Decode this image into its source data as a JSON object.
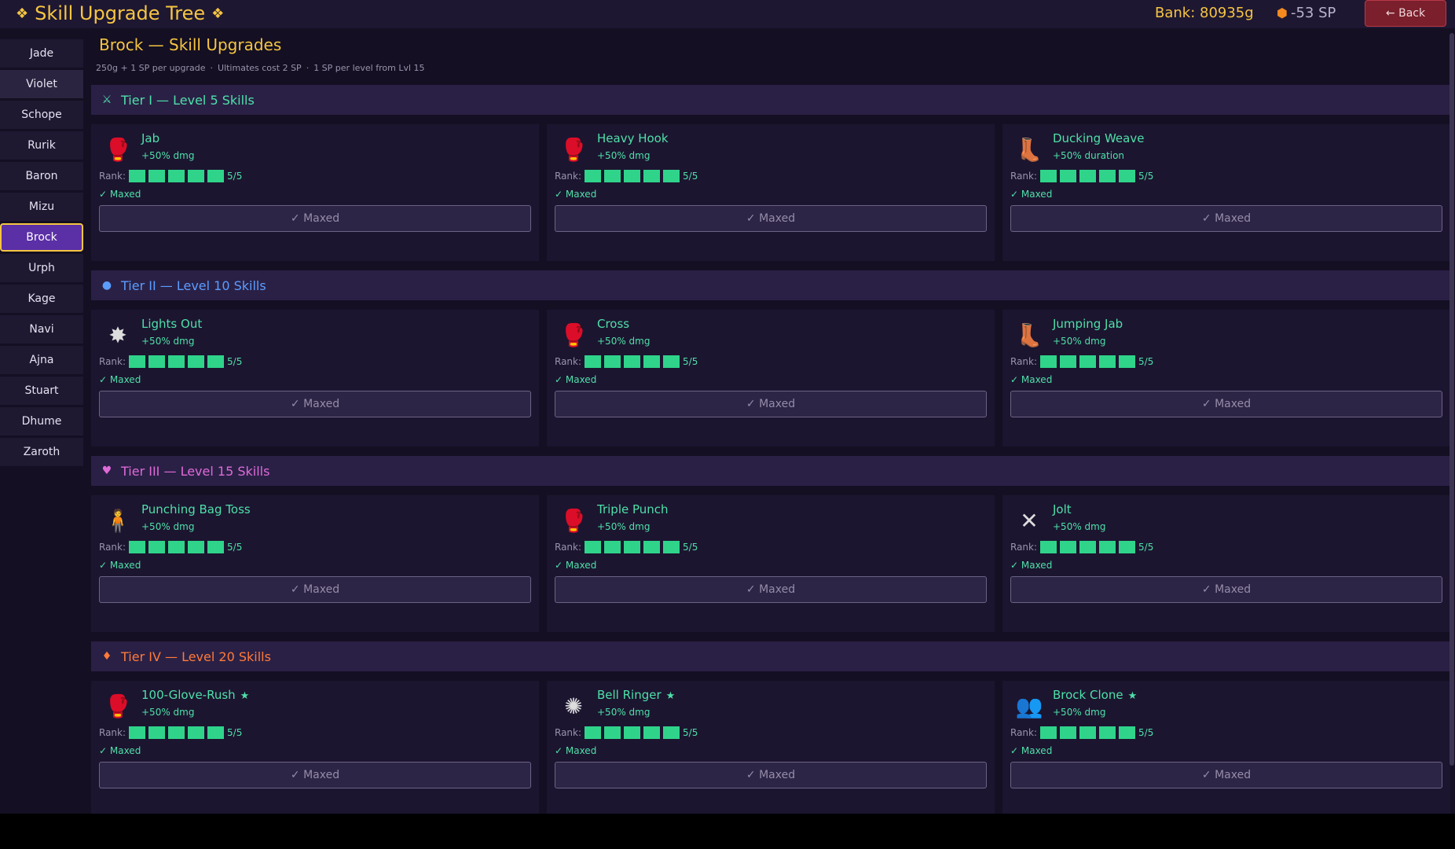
{
  "header": {
    "title": "Skill Upgrade Tree",
    "diamond": "❖",
    "bank": "Bank: 80935g",
    "sp": "-53 SP",
    "back_label": "← Back"
  },
  "sidebar": {
    "items": [
      {
        "label": "Jade"
      },
      {
        "label": "Violet"
      },
      {
        "label": "Schope"
      },
      {
        "label": "Rurik"
      },
      {
        "label": "Baron"
      },
      {
        "label": "Mizu"
      },
      {
        "label": "Brock"
      },
      {
        "label": "Urph"
      },
      {
        "label": "Kage"
      },
      {
        "label": "Navi"
      },
      {
        "label": "Ajna"
      },
      {
        "label": "Stuart"
      },
      {
        "label": "Dhume"
      },
      {
        "label": "Zaroth"
      }
    ],
    "active": "Brock"
  },
  "main": {
    "title": "Brock  —  Skill Upgrades",
    "subtitle": [
      "250g + 1 SP per upgrade",
      "Ultimates cost 2 SP",
      "1 SP per level from Lvl 15"
    ],
    "rank_label": "Rank:",
    "tiers": [
      {
        "label": "Tier I  — Level 5 Skills",
        "color": "#4ee0a8",
        "icon": "⚔",
        "skills": [
          {
            "name": "Jab",
            "effect": "+50% dmg",
            "rank": "5/5",
            "status": "✓ Maxed",
            "button": "✓ Maxed",
            "icon": "🥊",
            "icon_name": "boxing-glove-icon",
            "ult": ""
          },
          {
            "name": "Heavy Hook",
            "effect": "+50% dmg",
            "rank": "5/5",
            "status": "✓ Maxed",
            "button": "✓ Maxed",
            "icon": "🥊",
            "icon_name": "boxing-glove-icon",
            "ult": ""
          },
          {
            "name": "Ducking Weave",
            "effect": "+50% duration",
            "rank": "5/5",
            "status": "✓ Maxed",
            "button": "✓ Maxed",
            "icon": "👢",
            "icon_name": "boot-icon",
            "ult": ""
          }
        ]
      },
      {
        "label": "Tier II  — Level 10 Skills",
        "color": "#5b9dff",
        "icon": "●",
        "skills": [
          {
            "name": "Lights Out",
            "effect": "+50% dmg",
            "rank": "5/5",
            "status": "✓ Maxed",
            "button": "✓ Maxed",
            "icon": "✸",
            "icon_name": "star-burst-icon",
            "ult": ""
          },
          {
            "name": "Cross",
            "effect": "+50% dmg",
            "rank": "5/5",
            "status": "✓ Maxed",
            "button": "✓ Maxed",
            "icon": "🥊",
            "icon_name": "boxing-glove-icon",
            "ult": ""
          },
          {
            "name": "Jumping Jab",
            "effect": "+50% dmg",
            "rank": "5/5",
            "status": "✓ Maxed",
            "button": "✓ Maxed",
            "icon": "👢",
            "icon_name": "boot-icon",
            "ult": ""
          }
        ]
      },
      {
        "label": "Tier III — Level 15 Skills",
        "color": "#e06ad8",
        "icon": "♥",
        "skills": [
          {
            "name": "Punching Bag Toss",
            "effect": "+50% dmg",
            "rank": "5/5",
            "status": "✓ Maxed",
            "button": "✓ Maxed",
            "icon": "🧍",
            "icon_name": "punching-bag-icon",
            "ult": ""
          },
          {
            "name": "Triple Punch",
            "effect": "+50% dmg",
            "rank": "5/5",
            "status": "✓ Maxed",
            "button": "✓ Maxed",
            "icon": "🥊",
            "icon_name": "boxing-glove-icon",
            "ult": ""
          },
          {
            "name": "Jolt",
            "effect": "+50% dmg",
            "rank": "5/5",
            "status": "✓ Maxed",
            "button": "✓ Maxed",
            "icon": "✕",
            "icon_name": "lightning-icon",
            "ult": ""
          }
        ]
      },
      {
        "label": "Tier IV  — Level 20 Skills",
        "color": "#ff7a3a",
        "icon": "♦",
        "skills": [
          {
            "name": "100-Glove-Rush",
            "effect": "+50% dmg",
            "rank": "5/5",
            "status": "✓ Maxed",
            "button": "✓ Maxed",
            "icon": "🥊",
            "icon_name": "glove-cluster-icon",
            "ult": "★"
          },
          {
            "name": "Bell Ringer",
            "effect": "+50% dmg",
            "rank": "5/5",
            "status": "✓ Maxed",
            "button": "✓ Maxed",
            "icon": "✺",
            "icon_name": "bell-burst-icon",
            "ult": "★"
          },
          {
            "name": "Brock Clone",
            "effect": "+50% dmg",
            "rank": "5/5",
            "status": "✓ Maxed",
            "button": "✓ Maxed",
            "icon": "👥",
            "icon_name": "clone-icon",
            "ult": "★"
          }
        ]
      }
    ]
  },
  "colors": {
    "gold": "#f5c542",
    "green": "#4ee0a8",
    "pip": "#2fd48a",
    "active_tab": "#5b2fa6",
    "back": "#7a1f2b"
  },
  "rank_max": 5
}
